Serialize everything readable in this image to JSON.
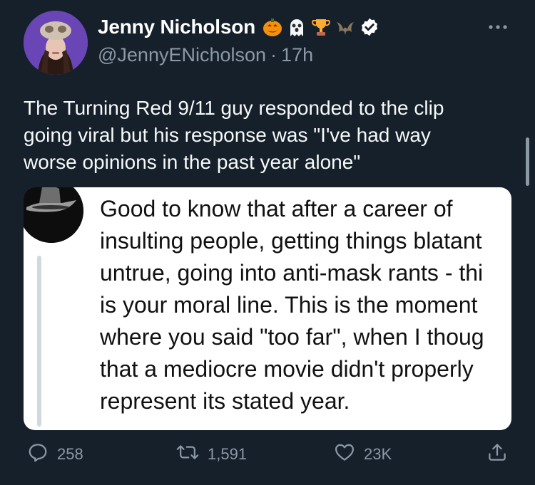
{
  "author": {
    "name": "Jenny Nicholson",
    "handle": "@JennyENicholson",
    "separator": "·",
    "time": "17h",
    "badges": [
      "jack-o-lantern-icon",
      "ghost-icon",
      "trophy-icon",
      "bat-icon",
      "verified-badge-icon"
    ]
  },
  "tweet": {
    "lines": [
      "The Turning Red 9/11 guy responded to the clip",
      "going viral but his response was \"I've had way",
      "worse opinions in the past year alone\""
    ]
  },
  "quote": {
    "lines": [
      "Good to know that after a career of",
      "insulting people, getting things blatant",
      "untrue, going into anti-mask rants - thi",
      "is your moral line. This is the moment",
      "where you said \"too far\", when I thoug",
      "that a mediocre movie didn't properly",
      "represent its stated year."
    ]
  },
  "actions": {
    "replies": "258",
    "retweets": "1,591",
    "likes": "23K"
  },
  "colors": {
    "background": "#15202b",
    "secondary_text": "#8b98a5",
    "verified": "#ffffff"
  }
}
